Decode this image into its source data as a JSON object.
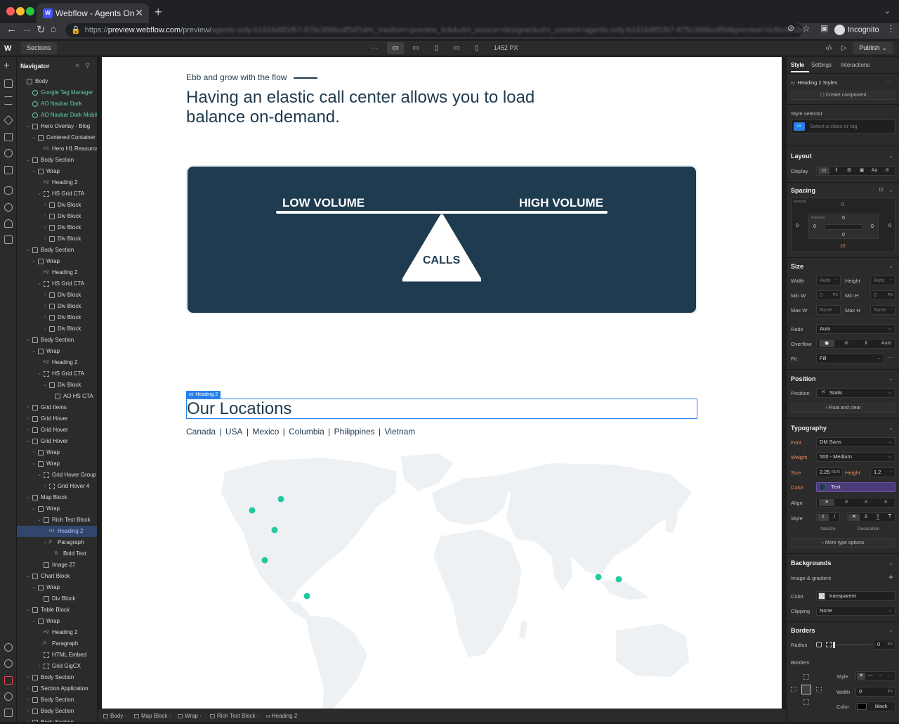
{
  "browser": {
    "tab_title": "Webflow - Agents Only Websit",
    "tab_close": "✕",
    "new_tab": "+",
    "url_scheme": "https://",
    "url_host": "preview.webflow.com",
    "url_path": "/preview/",
    "url_tail": "agents-only-b1916d8f1f67-875c3666cdf5d?utm_medium=preview_link&utm_source=designer&utm_content=agents-only-b1916d8f1f67-875c3666cdf5d&preview=0cf6c941be6a9bdbf",
    "profile_label": "Incognito"
  },
  "designer": {
    "sections_label": "Sections",
    "width_label": "1452 PX",
    "publish_label": "Publish",
    "breakpoints": [
      "desktop",
      "tablet-landscape",
      "tablet",
      "mobile-landscape",
      "mobile"
    ]
  },
  "navigator": {
    "title": "Navigator",
    "rows": [
      {
        "label": "Body",
        "tag": "",
        "depth": 0,
        "caret": "",
        "kind": "box",
        "sel": false
      },
      {
        "label": "Google Tag Manager",
        "tag": "",
        "depth": 1,
        "caret": "",
        "kind": "sym",
        "sel": false
      },
      {
        "label": "AO Navbar Dark",
        "tag": "",
        "depth": 1,
        "caret": "",
        "kind": "sym",
        "sel": false
      },
      {
        "label": "AO Navbar Dark Mobile",
        "tag": "",
        "depth": 1,
        "caret": "",
        "kind": "sym",
        "sel": false
      },
      {
        "label": "Hero Overlay - Blog",
        "tag": "",
        "depth": 1,
        "caret": "v",
        "kind": "box",
        "sel": false
      },
      {
        "label": "Centered Container 2",
        "tag": "",
        "depth": 2,
        "caret": "v",
        "kind": "box",
        "sel": false
      },
      {
        "label": "Hero H1 Resource",
        "tag": "H1",
        "depth": 3,
        "caret": "",
        "kind": "tag",
        "sel": false
      },
      {
        "label": "Body Section",
        "tag": "",
        "depth": 1,
        "caret": "v",
        "kind": "box",
        "sel": false
      },
      {
        "label": "Wrap",
        "tag": "",
        "depth": 2,
        "caret": "v",
        "kind": "box",
        "sel": false
      },
      {
        "label": "Heading 2",
        "tag": "H2",
        "depth": 3,
        "caret": "",
        "kind": "tag",
        "sel": false
      },
      {
        "label": "HS Grid CTA",
        "tag": "",
        "depth": 3,
        "caret": "v",
        "kind": "grid",
        "sel": false
      },
      {
        "label": "Div Block",
        "tag": "",
        "depth": 4,
        "caret": ">",
        "kind": "box",
        "sel": false
      },
      {
        "label": "Div Block",
        "tag": "",
        "depth": 4,
        "caret": ">",
        "kind": "box",
        "sel": false
      },
      {
        "label": "Div Block",
        "tag": "",
        "depth": 4,
        "caret": ">",
        "kind": "box",
        "sel": false
      },
      {
        "label": "Div Block",
        "tag": "",
        "depth": 4,
        "caret": ">",
        "kind": "box",
        "sel": false
      },
      {
        "label": "Body Section",
        "tag": "",
        "depth": 1,
        "caret": "v",
        "kind": "box",
        "sel": false
      },
      {
        "label": "Wrap",
        "tag": "",
        "depth": 2,
        "caret": "v",
        "kind": "box",
        "sel": false
      },
      {
        "label": "Heading 2",
        "tag": "H2",
        "depth": 3,
        "caret": "",
        "kind": "tag",
        "sel": false
      },
      {
        "label": "HS Grid CTA",
        "tag": "",
        "depth": 3,
        "caret": "v",
        "kind": "grid",
        "sel": false
      },
      {
        "label": "Div Block",
        "tag": "",
        "depth": 4,
        "caret": ">",
        "kind": "box",
        "sel": false
      },
      {
        "label": "Div Block",
        "tag": "",
        "depth": 4,
        "caret": ">",
        "kind": "box",
        "sel": false
      },
      {
        "label": "Div Block",
        "tag": "",
        "depth": 4,
        "caret": ">",
        "kind": "box",
        "sel": false
      },
      {
        "label": "Div Block",
        "tag": "",
        "depth": 4,
        "caret": ">",
        "kind": "box",
        "sel": false
      },
      {
        "label": "Body Section",
        "tag": "",
        "depth": 1,
        "caret": "v",
        "kind": "box",
        "sel": false
      },
      {
        "label": "Wrap",
        "tag": "",
        "depth": 2,
        "caret": "v",
        "kind": "box",
        "sel": false
      },
      {
        "label": "Heading 2",
        "tag": "H2",
        "depth": 3,
        "caret": "",
        "kind": "tag",
        "sel": false
      },
      {
        "label": "HS Grid CTA",
        "tag": "",
        "depth": 3,
        "caret": "v",
        "kind": "grid",
        "sel": false
      },
      {
        "label": "Div Block",
        "tag": "",
        "depth": 4,
        "caret": "v",
        "kind": "box",
        "sel": false
      },
      {
        "label": "AO HS CTA",
        "tag": "",
        "depth": 5,
        "caret": "",
        "kind": "hand",
        "sel": false
      },
      {
        "label": "Grid Items",
        "tag": "",
        "depth": 1,
        "caret": ">",
        "kind": "box",
        "sel": false
      },
      {
        "label": "Grid Hover",
        "tag": "",
        "depth": 1,
        "caret": ">",
        "kind": "box",
        "sel": false
      },
      {
        "label": "Grid Hover",
        "tag": "",
        "depth": 1,
        "caret": ">",
        "kind": "box",
        "sel": false
      },
      {
        "label": "Grid Hover",
        "tag": "",
        "depth": 1,
        "caret": "v",
        "kind": "box",
        "sel": false
      },
      {
        "label": "Wrap",
        "tag": "",
        "depth": 2,
        "caret": ">",
        "kind": "box",
        "sel": false
      },
      {
        "label": "Wrap",
        "tag": "",
        "depth": 2,
        "caret": "v",
        "kind": "box",
        "sel": false
      },
      {
        "label": "Grid Hover Group F1",
        "tag": "",
        "depth": 3,
        "caret": "v",
        "kind": "grid",
        "sel": false
      },
      {
        "label": "Grid Hover 4",
        "tag": "",
        "depth": 4,
        "caret": ">",
        "kind": "grid",
        "sel": false
      },
      {
        "label": "Map Block",
        "tag": "",
        "depth": 1,
        "caret": "v",
        "kind": "box",
        "sel": false
      },
      {
        "label": "Wrap",
        "tag": "",
        "depth": 2,
        "caret": "v",
        "kind": "box",
        "sel": false
      },
      {
        "label": "Rich Text Block",
        "tag": "",
        "depth": 3,
        "caret": "v",
        "kind": "rich",
        "sel": false
      },
      {
        "label": "Heading 2",
        "tag": "H2",
        "depth": 4,
        "caret": "",
        "kind": "tag",
        "sel": true
      },
      {
        "label": "Paragraph",
        "tag": "P",
        "depth": 4,
        "caret": "v",
        "kind": "tag",
        "sel": false
      },
      {
        "label": "Bold Text",
        "tag": "B",
        "depth": 5,
        "caret": "",
        "kind": "tag",
        "sel": false
      },
      {
        "label": "Image 27",
        "tag": "",
        "depth": 3,
        "caret": "",
        "kind": "img",
        "sel": false
      },
      {
        "label": "Chart Block",
        "tag": "",
        "depth": 1,
        "caret": "v",
        "kind": "box",
        "sel": false
      },
      {
        "label": "Wrap",
        "tag": "",
        "depth": 2,
        "caret": "v",
        "kind": "box",
        "sel": false
      },
      {
        "label": "Div Block",
        "tag": "",
        "depth": 3,
        "caret": "",
        "kind": "box",
        "sel": false
      },
      {
        "label": "Table Block",
        "tag": "",
        "depth": 1,
        "caret": "v",
        "kind": "box",
        "sel": false
      },
      {
        "label": "Wrap",
        "tag": "",
        "depth": 2,
        "caret": "v",
        "kind": "box",
        "sel": false
      },
      {
        "label": "Heading 2",
        "tag": "H2",
        "depth": 3,
        "caret": "",
        "kind": "tag",
        "sel": false
      },
      {
        "label": "Paragraph",
        "tag": "P",
        "depth": 3,
        "caret": "",
        "kind": "tag",
        "sel": false
      },
      {
        "label": "HTML Embed",
        "tag": "",
        "depth": 3,
        "caret": "",
        "kind": "grid",
        "sel": false
      },
      {
        "label": "Grid GigCX",
        "tag": "",
        "depth": 3,
        "caret": ">",
        "kind": "grid",
        "sel": false
      },
      {
        "label": "Body Section",
        "tag": "",
        "depth": 1,
        "caret": ">",
        "kind": "box",
        "sel": false
      },
      {
        "label": "Section Application",
        "tag": "",
        "depth": 1,
        "caret": ">",
        "kind": "box",
        "sel": false
      },
      {
        "label": "Body Section",
        "tag": "",
        "depth": 1,
        "caret": ">",
        "kind": "box",
        "sel": false
      },
      {
        "label": "Body Section",
        "tag": "",
        "depth": 1,
        "caret": ">",
        "kind": "box",
        "sel": false
      },
      {
        "label": "Body Section",
        "tag": "",
        "depth": 1,
        "caret": ">",
        "kind": "box",
        "sel": false
      }
    ]
  },
  "canvas": {
    "eyebrow": "Ebb and grow with the flow",
    "hero_title": "Having an elastic call center allows you to load balance on-demand.",
    "scale": {
      "low_label": "LOW VOLUME",
      "high_label": "HIGH VOLUME",
      "fulcrum_label": "CALLS"
    },
    "selected_badge": "Heading 2",
    "selected_badge_tag": "H2",
    "locations_heading": "Our Locations",
    "locations": [
      "Canada",
      "USA",
      "Mexico",
      "Columbia",
      "Philippines",
      "Vietnam"
    ],
    "location_separator": "|",
    "accent_color": "#1e3b50",
    "marker_color": "#21c9a0"
  },
  "breadcrumbs": [
    "Body",
    "Map Block",
    "Wrap",
    "Rich Text Block",
    "Heading 2"
  ],
  "breadcrumb_tag": "H2",
  "style_panel": {
    "tabs": [
      "Style",
      "Settings",
      "Interactions"
    ],
    "selected_element": "Heading 2 Styles",
    "selected_tag": "H2",
    "create_component": "Create component",
    "style_selector_label": "Style selector",
    "selector_placeholder": "Select a class or tag",
    "layout": {
      "title": "Layout",
      "display_label": "Display"
    },
    "spacing": {
      "title": "Spacing",
      "margin_label": "MARGIN",
      "padding_label": "PADDING",
      "margin_top": "0",
      "margin_bottom": "16",
      "margin_left": "0",
      "margin_right": "0",
      "padding_top": "0",
      "padding_bottom": "0",
      "padding_left": "0",
      "padding_right": "0"
    },
    "size": {
      "title": "Size",
      "width_label": "Width",
      "width_value": "Auto",
      "height_label": "Height",
      "height_value": "Auto",
      "minw_label": "Min W",
      "minw_value": "0",
      "minw_unit": "PX",
      "minh_label": "Min H",
      "minh_value": "0",
      "minh_unit": "PX",
      "maxw_label": "Max W",
      "maxw_value": "None",
      "maxh_label": "Max H",
      "maxh_value": "None",
      "ratio_label": "Ratio",
      "ratio_value": "Auto",
      "overflow_label": "Overflow",
      "overflow_auto": "Auto",
      "fit_label": "Fit",
      "fit_value": "Fill"
    },
    "position": {
      "title": "Position",
      "position_label": "Position",
      "position_value": "Static",
      "float_button": "Float and clear"
    },
    "typography": {
      "title": "Typography",
      "font_label": "Font",
      "font_value": "DM Sans",
      "weight_label": "Weight",
      "weight_value": "500 - Medium",
      "size_label": "Size",
      "size_value": "2.25",
      "size_unit": "REM",
      "height_label": "Height",
      "height_value": "1.2",
      "color_label": "Color",
      "color_value": "Text",
      "align_label": "Align",
      "style_label": "Style",
      "italicize_label": "Italicize",
      "decoration_label": "Decoration",
      "more_options": "More type options"
    },
    "backgrounds": {
      "title": "Backgrounds",
      "image_gradient": "Image & gradient",
      "color_label": "Color",
      "color_value": "transparent",
      "clipping_label": "Clipping",
      "clipping_value": "None"
    },
    "borders": {
      "title": "Borders",
      "radius_label": "Radius",
      "radius_value": "0",
      "radius_unit": "PX",
      "borders_label": "Borders",
      "style_label": "Style",
      "width_label": "Width",
      "width_value": "0",
      "width_unit": "PX",
      "color_label": "Color",
      "color_value": "black"
    }
  }
}
